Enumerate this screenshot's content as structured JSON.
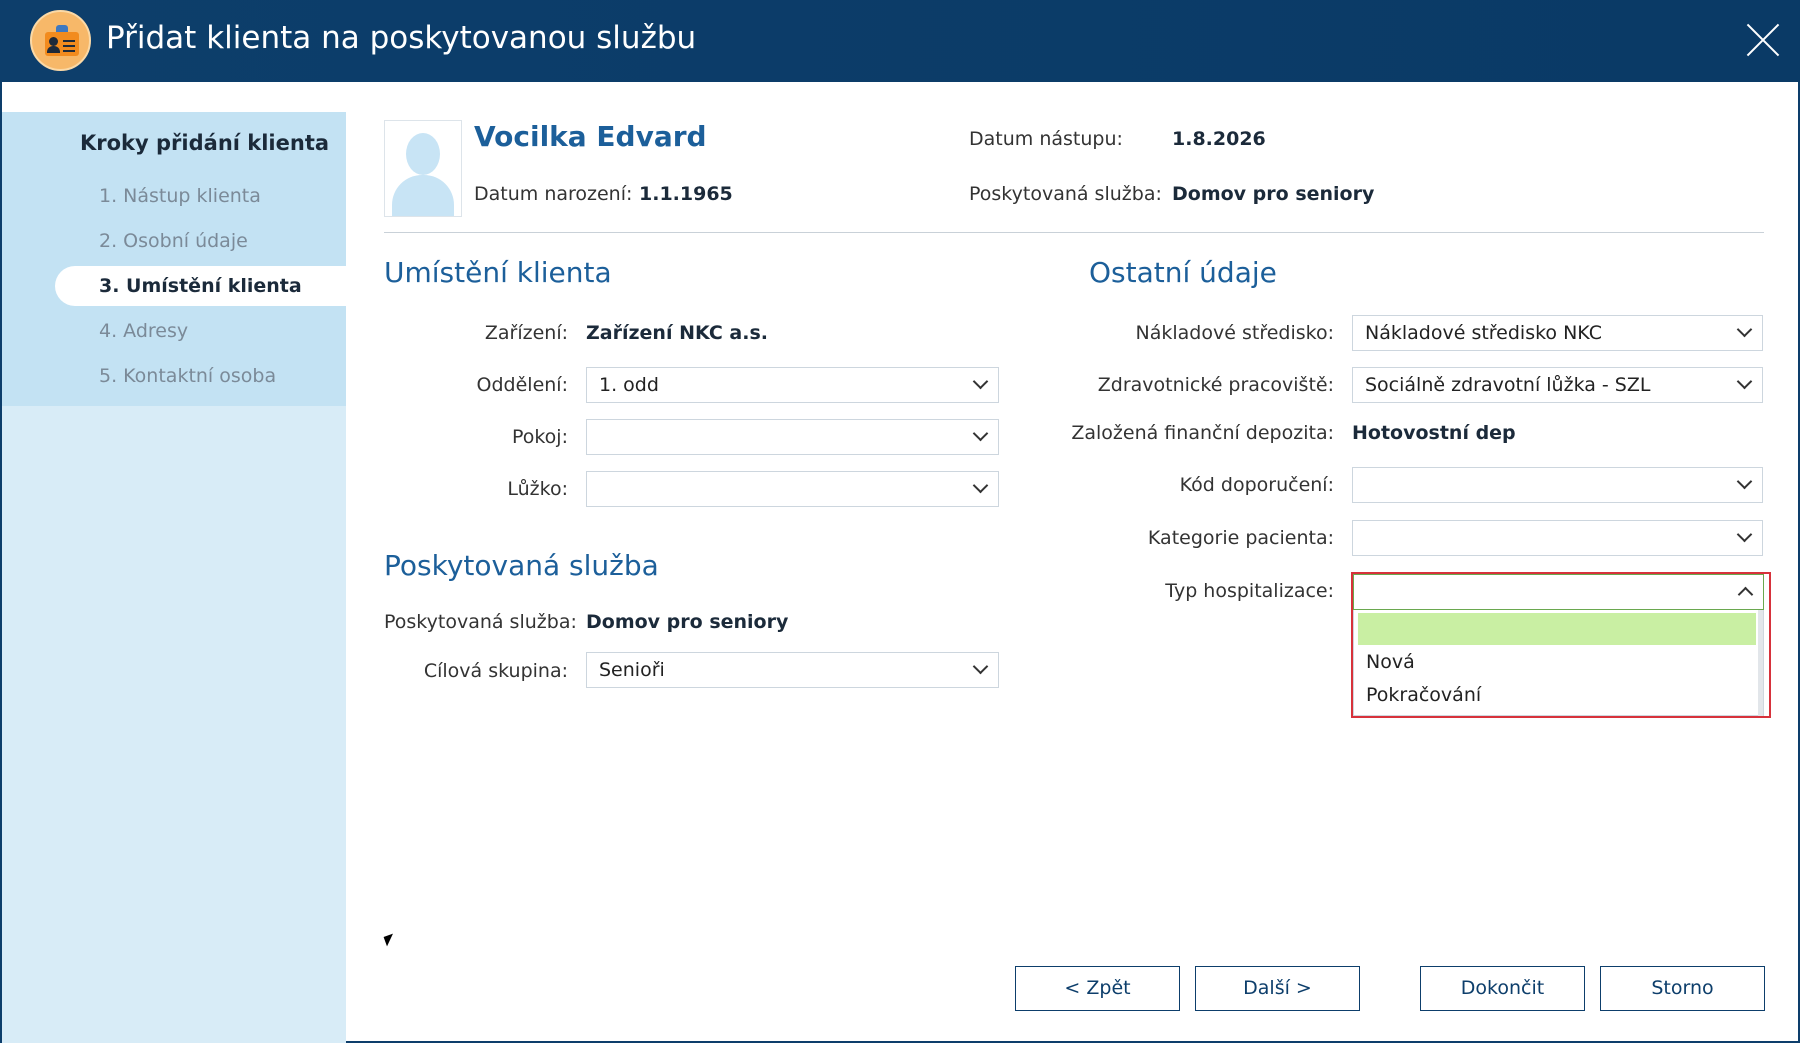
{
  "window": {
    "title": "Přidat klienta na poskytovanou službu"
  },
  "sidebar": {
    "title": "Kroky přidání klienta",
    "steps": [
      {
        "label": "1. Nástup klienta"
      },
      {
        "label": "2. Osobní údaje"
      },
      {
        "label": "3. Umístění klienta"
      },
      {
        "label": "4. Adresy"
      },
      {
        "label": "5. Kontaktní osoba"
      }
    ],
    "active_step": 3
  },
  "client": {
    "name": "Vocilka Edvard",
    "birth_label": "Datum narození:",
    "birth_value": "1.1.1965",
    "start_label": "Datum nástupu:",
    "start_value": "1.8.2026",
    "service_label": "Poskytovaná služba:",
    "service_value": "Domov pro seniory"
  },
  "placement": {
    "heading": "Umístění klienta",
    "facility_label": "Zařízení:",
    "facility_value": "Zařízení NKC a.s.",
    "department_label": "Oddělení:",
    "department_value": "1. odd",
    "room_label": "Pokoj:",
    "room_value": "",
    "bed_label": "Lůžko:",
    "bed_value": ""
  },
  "service": {
    "heading": "Poskytovaná služba",
    "service_label": "Poskytovaná služba:",
    "service_value": "Domov pro seniory",
    "target_label": "Cílová skupina:",
    "target_value": "Senioři"
  },
  "other": {
    "heading": "Ostatní údaje",
    "cost_center_label": "Nákladové středisko:",
    "cost_center_value": "Nákladové středisko NKC",
    "workplace_label": "Zdravotnické pracoviště:",
    "workplace_value": "Sociálně zdravotní lůžka - SZL",
    "deposit_label": "Založená finanční depozita:",
    "deposit_value": "Hotovostní dep",
    "referral_label": "Kód doporučení:",
    "referral_value": "",
    "category_label": "Kategorie pacienta:",
    "category_value": "",
    "hosp_label": "Typ hospitalizace:",
    "hosp_value": "",
    "hosp_options": [
      "",
      "Nová",
      "Pokračování"
    ]
  },
  "buttons": {
    "back": "< Zpět",
    "next": "Další >",
    "finish": "Dokončit",
    "cancel": "Storno"
  },
  "colors": {
    "titlebar": "#0d3e6b",
    "accent": "#1c5f9a",
    "sidebar": "#c3e2f3",
    "selected_option": "#c9efa3",
    "highlight_frame": "#d7323b"
  }
}
